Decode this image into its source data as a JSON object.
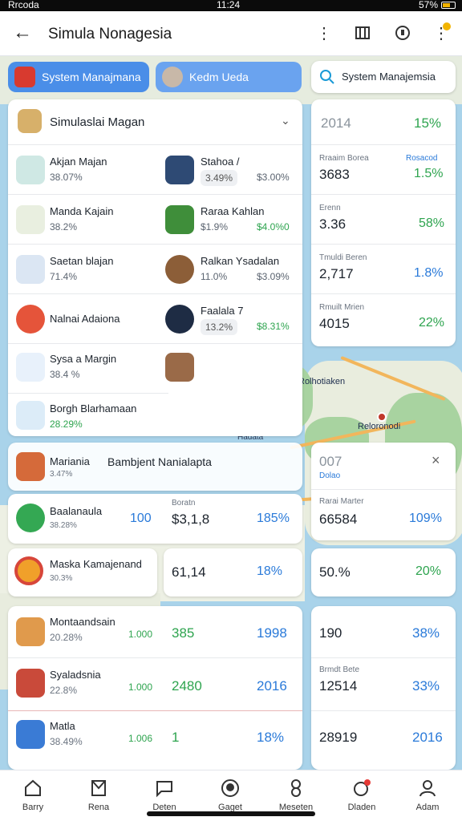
{
  "status_bar": {
    "left": "Rrcoda",
    "time": "11:24",
    "right": "57%"
  },
  "app_bar": {
    "title": "Simula Nonagesia"
  },
  "pills": [
    {
      "label": "System Manajmana",
      "color": "#4a8ee8"
    },
    {
      "label": "Kedm Ueda",
      "color": "#6aa3ef"
    }
  ],
  "search": {
    "label": "System Manajemsia"
  },
  "panel": {
    "header": "Simulaslai Magan",
    "items": [
      {
        "name": "Akjan Majan",
        "pct": "38.07%"
      },
      {
        "name": "Stahoa /",
        "pct": "3.49%",
        "value": "$3.00%"
      },
      {
        "name": "Manda Kajain",
        "pct": "38.2%"
      },
      {
        "name": "Raraa Kahlan",
        "pct": "$1.9%",
        "value": "$4.0%0"
      },
      {
        "name": "Saetan blajan",
        "pct": "71.4%"
      },
      {
        "name": "Ralkan Ysadalan",
        "pct": "11.0%",
        "value": "$3.09%"
      },
      {
        "name": "Nalnai Adaiona"
      },
      {
        "name": "Faalala 7",
        "pct": "13.2%",
        "value": "$8.31%"
      },
      {
        "name": "Sysa a Margin",
        "pct": "38.4 %"
      },
      {
        "name": "Borgh Blarhamaan",
        "pct": "28.29%"
      }
    ]
  },
  "right_panel": {
    "year": "2014",
    "year_pct": "15%",
    "rows": [
      {
        "label": "Rraaim Borea",
        "label2": "Rosacod",
        "value": "3683",
        "pct": "1.5%"
      },
      {
        "label": "Erenn",
        "value": "3.36",
        "pct": "58%"
      },
      {
        "label": "Tmuldi Beren",
        "value": "2,717",
        "pct": "1.8%"
      },
      {
        "label": "Rmuilt Mrien",
        "value": "4015",
        "pct": "22%"
      }
    ]
  },
  "map_labels": {
    "city1": "Rolhotiaken",
    "city2": "Reloronodi",
    "water": "Hadata"
  },
  "lower_left": [
    {
      "name": "Mariania",
      "pct": "3.47%",
      "tag": "Bambjent Nanialapta"
    },
    {
      "name": "Baalanaula",
      "pct": "38.28%",
      "num": "100",
      "mid_label": "Boratn",
      "mid": "$3,1,8",
      "pct2": "185%"
    },
    {
      "name": "Maska Kamajenand",
      "pct": "30.3%"
    }
  ],
  "lower_mid": {
    "value": "61,14",
    "pct": "18%"
  },
  "lower_right_card": {
    "title": "007",
    "subtitle": "Dolao",
    "label": "Rarai Marter",
    "value": "66584",
    "pct": "109%"
  },
  "lower_right2": {
    "value": "50.%",
    "pct": "20%"
  },
  "bottom_list": [
    {
      "name": "Montaandsain",
      "pct": "20.28%",
      "num": "1.000",
      "v1": "385",
      "v2": "1998"
    },
    {
      "name": "Syaladsnia",
      "pct": "22.8%",
      "num": "1.000",
      "v1": "2480",
      "v2": "2016"
    },
    {
      "name": "Matla",
      "pct": "38.49%",
      "num": "1.006",
      "v1": "1",
      "v2": "18%"
    }
  ],
  "bottom_right": [
    {
      "value": "190",
      "pct": "38%"
    },
    {
      "label": "Brmdt Bete",
      "value": "12514",
      "pct": "33%"
    },
    {
      "value": "28919",
      "pct": "2016"
    }
  ],
  "nav": [
    {
      "label": "Barry",
      "icon": "home-icon"
    },
    {
      "label": "Rena",
      "icon": "book-icon"
    },
    {
      "label": "Deten",
      "icon": "chat-icon"
    },
    {
      "label": "Gaget",
      "icon": "face-icon"
    },
    {
      "label": "Meseten",
      "icon": "eight-icon"
    },
    {
      "label": "Dladen",
      "icon": "alarm-icon"
    },
    {
      "label": "Adam",
      "icon": "person-icon"
    }
  ]
}
